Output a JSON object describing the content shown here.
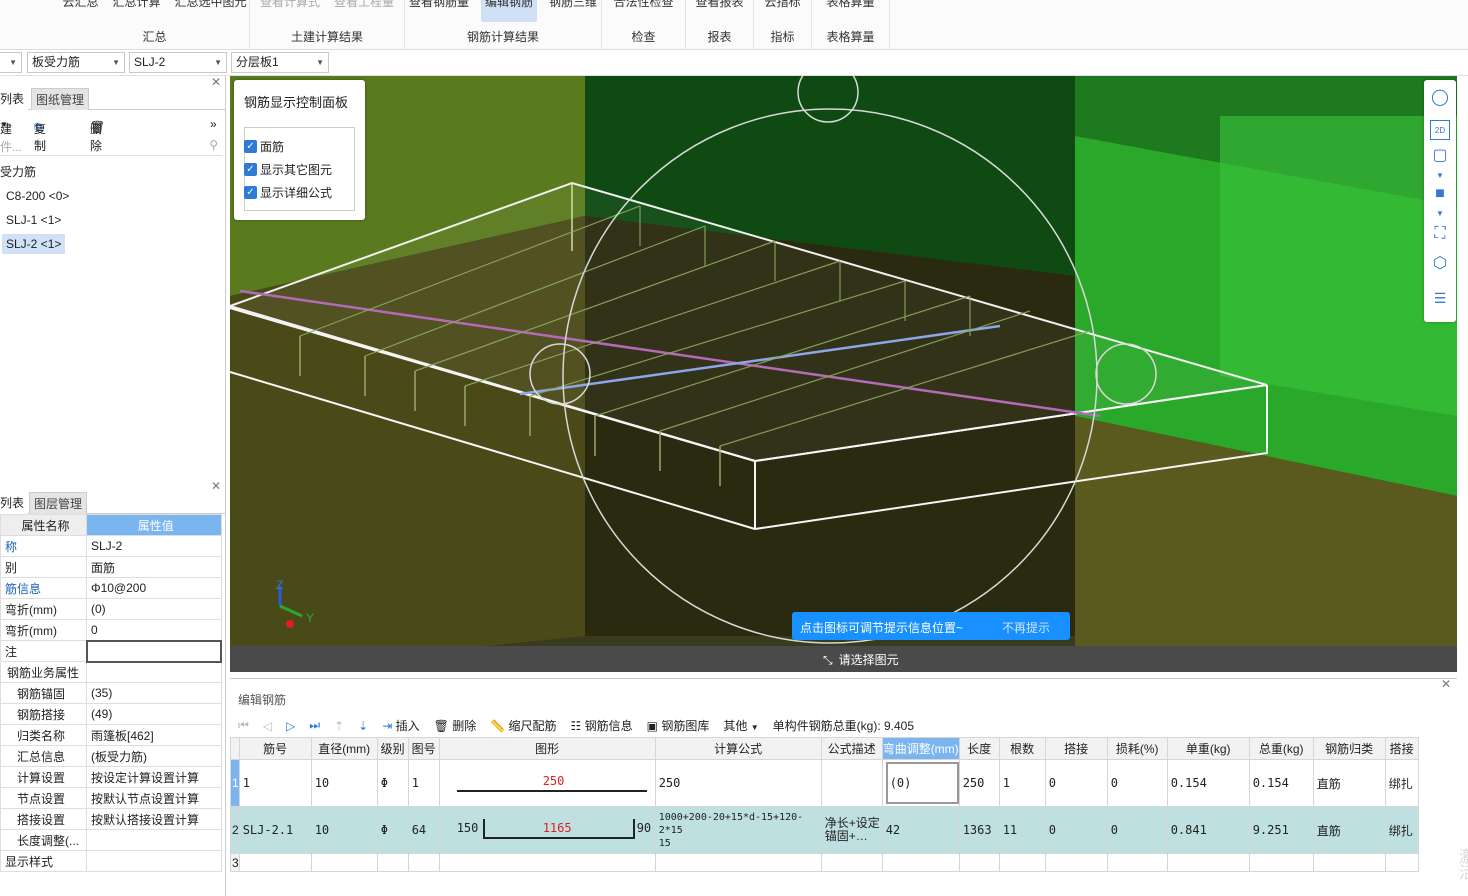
{
  "ribbon": {
    "groups": [
      {
        "label": "汇总",
        "buttons": [
          "云汇总",
          "汇总计算",
          "汇总选中图元"
        ],
        "dim": [
          false,
          false,
          false
        ]
      },
      {
        "label": "土建计算结果",
        "buttons": [
          "查看计算式",
          "查看工程量"
        ],
        "dim": [
          true,
          true
        ]
      },
      {
        "label": "钢筋计算结果",
        "buttons": [
          "查看钢筋量",
          "编辑钢筋",
          "钢筋三维"
        ],
        "active": "编辑钢筋"
      },
      {
        "label": "检查",
        "buttons": [
          "合法性检查"
        ]
      },
      {
        "label": "报表",
        "buttons": [
          "查看报表"
        ]
      },
      {
        "label": "指标",
        "buttons": [
          "云指标"
        ]
      },
      {
        "label": "表格算量",
        "buttons": [
          "表格算量"
        ]
      }
    ]
  },
  "selectors": {
    "s1": "板受力筋",
    "s2": "SLJ-2",
    "s3": "分层板1"
  },
  "left": {
    "tab_list": "列表",
    "tab_drawing": "图纸管理",
    "new_label": "建",
    "copy_label": "复制",
    "delete_label": "删除",
    "search_placeholder": "件...",
    "tree_parent": "受力筋",
    "tree_items": [
      "C8-200 <0>",
      "SLJ-1 <1>",
      "SLJ-2 <1>"
    ],
    "prop_tab_list": "列表",
    "prop_tab_layer": "图层管理",
    "prop_header_name": "属性名称",
    "prop_header_value": "属性值",
    "props": [
      {
        "k": "称",
        "v": "SLJ-2",
        "blue": true
      },
      {
        "k": "别",
        "v": "面筋",
        "blue": false
      },
      {
        "k": "筋信息",
        "v": "Φ10@200",
        "blue": true
      },
      {
        "k": "弯折(mm)",
        "v": "(0)",
        "blue": false
      },
      {
        "k": "弯折(mm)",
        "v": "0",
        "blue": false
      },
      {
        "k": "注",
        "v": "",
        "blue": false
      },
      {
        "k": "钢筋业务属性",
        "v": "",
        "blue": false
      },
      {
        "k": "钢筋锚固",
        "v": "(35)",
        "blue": false
      },
      {
        "k": "钢筋搭接",
        "v": "(49)",
        "blue": false
      },
      {
        "k": "归类名称",
        "v": "雨篷板[462]",
        "blue": false
      },
      {
        "k": "汇总信息",
        "v": "(板受力筋)",
        "blue": false
      },
      {
        "k": "计算设置",
        "v": "按设定计算设置计算",
        "blue": false
      },
      {
        "k": "节点设置",
        "v": "按默认节点设置计算",
        "blue": false
      },
      {
        "k": "搭接设置",
        "v": "按默认搭接设置计算",
        "blue": false
      },
      {
        "k": "长度调整(...",
        "v": "",
        "blue": false
      },
      {
        "k": "显示样式",
        "v": "",
        "blue": false
      }
    ]
  },
  "viewport": {
    "panel_title": "钢筋显示控制面板",
    "checks": [
      "面筋",
      "显示其它图元",
      "显示详细公式"
    ],
    "tip_text": "点击图标可调节提示信息位置~",
    "tip_dismiss": "不再提示",
    "status": "请选择图元",
    "axis_z": "Z",
    "axis_y": "Y",
    "tool_2d": "2D"
  },
  "edit": {
    "title": "编辑钢筋",
    "insert": "插入",
    "delete": "删除",
    "scale": "缩尺配筋",
    "info": "钢筋信息",
    "library": "钢筋图库",
    "other": "其他",
    "total": "单构件钢筋总重(kg): 9.405",
    "columns": [
      "筋号",
      "直径(mm)",
      "级别",
      "图号",
      "图形",
      "计算公式",
      "公式描述",
      "弯曲调整(mm)",
      "长度",
      "根数",
      "搭接",
      "损耗(%)",
      "单重(kg)",
      "总重(kg)",
      "钢筋归类",
      "搭接"
    ],
    "rows": [
      {
        "n": "1",
        "name": "1",
        "dia": "10",
        "grade": "Φ",
        "fig": "1",
        "shape_left": "",
        "shape_mid": "250",
        "shape_right": "",
        "formula": "250",
        "desc": "",
        "adjust": "(0)",
        "len": "250",
        "count": "1",
        "lap": "0",
        "loss": "0",
        "unit": "0.154",
        "total": "0.154",
        "cls": "直筋",
        "lapt": "绑扎"
      },
      {
        "n": "2",
        "name": "SLJ-2.1",
        "dia": "10",
        "grade": "Φ",
        "fig": "64",
        "shape_left": "150",
        "shape_mid": "1165",
        "shape_right": "90",
        "formula": "1000+200-20+15*d-15+120-2*15",
        "formula2": "15",
        "desc": "净长+设定锚固+…",
        "adjust": "42",
        "len": "1363",
        "count": "11",
        "lap": "0",
        "loss": "0",
        "unit": "0.841",
        "total": "9.251",
        "cls": "直筋",
        "lapt": "绑扎"
      },
      {
        "n": "3"
      }
    ]
  },
  "watermark": "激活"
}
